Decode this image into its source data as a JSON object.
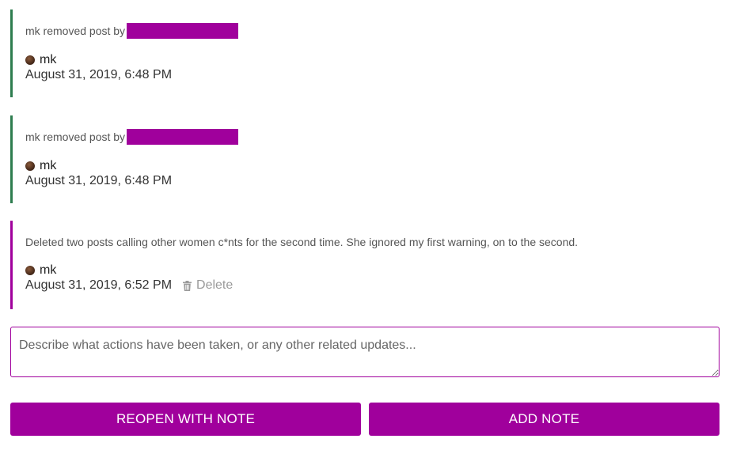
{
  "notes": [
    {
      "kind": "action",
      "text": "mk removed post by",
      "redacted": true,
      "author": "mk",
      "timestamp": "August 31, 2019, 6:48 PM"
    },
    {
      "kind": "action",
      "text": "mk removed post by",
      "redacted": true,
      "author": "mk",
      "timestamp": "August 31, 2019, 6:48 PM"
    },
    {
      "kind": "user-note",
      "text": "Deleted two posts calling other women c*nts for the second time. She ignored my first warning, on to the second.",
      "author": "mk",
      "timestamp": "August 31, 2019, 6:52 PM",
      "delete_label": "Delete"
    }
  ],
  "input": {
    "placeholder": "Describe what actions have been taken, or any other related updates...",
    "value": ""
  },
  "buttons": {
    "reopen_label": "Reopen with note",
    "add_label": "Add note"
  },
  "colors": {
    "accent": "#a0009c",
    "action_border": "#2e7d4f",
    "note_border": "#a0009c"
  },
  "icons": {
    "avatar": "user-avatar",
    "delete": "trash-icon"
  }
}
